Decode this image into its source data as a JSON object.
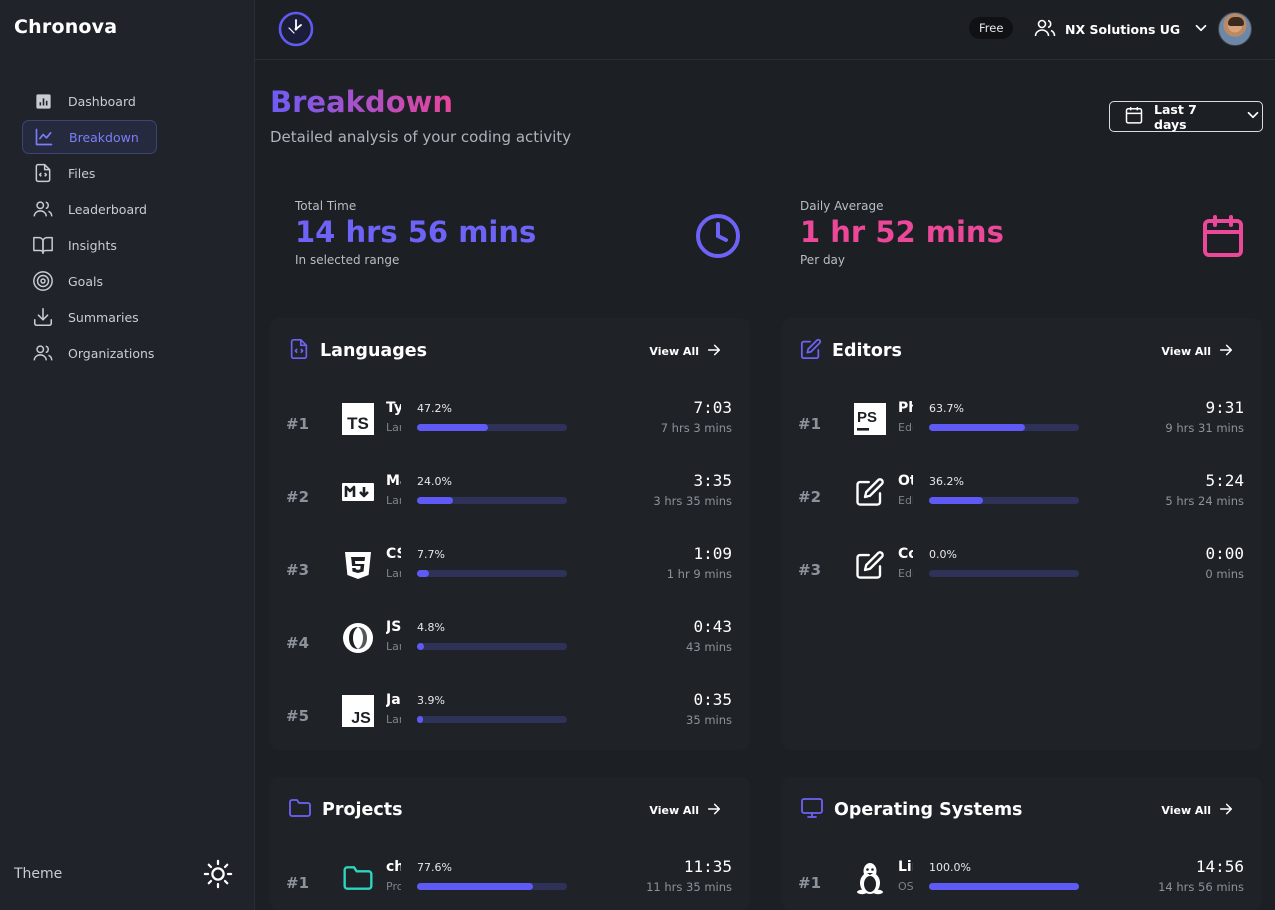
{
  "app": {
    "name": "Chronova"
  },
  "sidebar": {
    "items": [
      {
        "label": "Dashboard",
        "icon": "bar-chart-icon",
        "active": false
      },
      {
        "label": "Breakdown",
        "icon": "line-chart-icon",
        "active": true
      },
      {
        "label": "Files",
        "icon": "file-code-icon",
        "active": false
      },
      {
        "label": "Leaderboard",
        "icon": "users-icon",
        "active": false
      },
      {
        "label": "Insights",
        "icon": "book-open-icon",
        "active": false
      },
      {
        "label": "Goals",
        "icon": "target-icon",
        "active": false
      },
      {
        "label": "Summaries",
        "icon": "download-icon",
        "active": false
      },
      {
        "label": "Organizations",
        "icon": "users-icon",
        "active": false
      }
    ],
    "theme_label": "Theme"
  },
  "topbar": {
    "plan": "Free",
    "org_name": "NX Solutions UG"
  },
  "header": {
    "title": "Breakdown",
    "subtitle": "Detailed analysis of your coding activity",
    "range": "Last 7 days"
  },
  "stats": {
    "total": {
      "label": "Total Time",
      "value": "14 hrs 56 mins",
      "sub": "In selected range"
    },
    "average": {
      "label": "Daily Average",
      "value": "1 hr 52 mins",
      "sub": "Per day"
    }
  },
  "view_all_label": "View All",
  "panels": {
    "languages": {
      "title": "Languages",
      "rows": [
        {
          "rank": "#1",
          "name": "TypeScript",
          "category": "Language",
          "percent": "47.2%",
          "fraction": 0.472,
          "clock": "7:03",
          "duration": "7 hrs 3 mins",
          "icon": "typescript-icon"
        },
        {
          "rank": "#2",
          "name": "Markdown",
          "category": "Language",
          "percent": "24.0%",
          "fraction": 0.24,
          "clock": "3:35",
          "duration": "3 hrs 35 mins",
          "icon": "markdown-icon"
        },
        {
          "rank": "#3",
          "name": "CSS",
          "category": "Language",
          "percent": "7.7%",
          "fraction": 0.077,
          "clock": "1:09",
          "duration": "1 hr 9 mins",
          "icon": "css-icon"
        },
        {
          "rank": "#4",
          "name": "JSON",
          "category": "Language",
          "percent": "4.8%",
          "fraction": 0.048,
          "clock": "0:43",
          "duration": "43 mins",
          "icon": "json-icon"
        },
        {
          "rank": "#5",
          "name": "JavaScript",
          "category": "Language",
          "percent": "3.9%",
          "fraction": 0.039,
          "clock": "0:35",
          "duration": "35 mins",
          "icon": "javascript-icon"
        }
      ]
    },
    "editors": {
      "title": "Editors",
      "rows": [
        {
          "rank": "#1",
          "name": "PhpStorm",
          "category": "Editor",
          "percent": "63.7%",
          "fraction": 0.637,
          "clock": "9:31",
          "duration": "9 hrs 31 mins",
          "icon": "phpstorm-icon"
        },
        {
          "rank": "#2",
          "name": "Other",
          "category": "Editor",
          "percent": "36.2%",
          "fraction": 0.362,
          "clock": "5:24",
          "duration": "5 hrs 24 mins",
          "icon": "edit-icon"
        },
        {
          "rank": "#3",
          "name": "Code",
          "category": "Editor",
          "percent": "0.0%",
          "fraction": 0.0,
          "clock": "0:00",
          "duration": "0 mins",
          "icon": "edit-icon"
        }
      ]
    },
    "projects": {
      "title": "Projects",
      "rows": [
        {
          "rank": "#1",
          "name": "chronova",
          "category": "Project",
          "percent": "77.6%",
          "fraction": 0.776,
          "clock": "11:35",
          "duration": "11 hrs 35 mins",
          "icon": "folder-icon"
        }
      ]
    },
    "os": {
      "title": "Operating Systems",
      "rows": [
        {
          "rank": "#1",
          "name": "Linux",
          "category": "OS",
          "percent": "100.0%",
          "fraction": 1.0,
          "clock": "14:56",
          "duration": "14 hrs 56 mins",
          "icon": "linux-icon"
        }
      ]
    }
  },
  "colors": {
    "accent": "#5f5af5",
    "accent_text": "#6d63f6",
    "pink": "#ec4899",
    "teal": "#2dd4bf",
    "track": "#2e3158"
  }
}
